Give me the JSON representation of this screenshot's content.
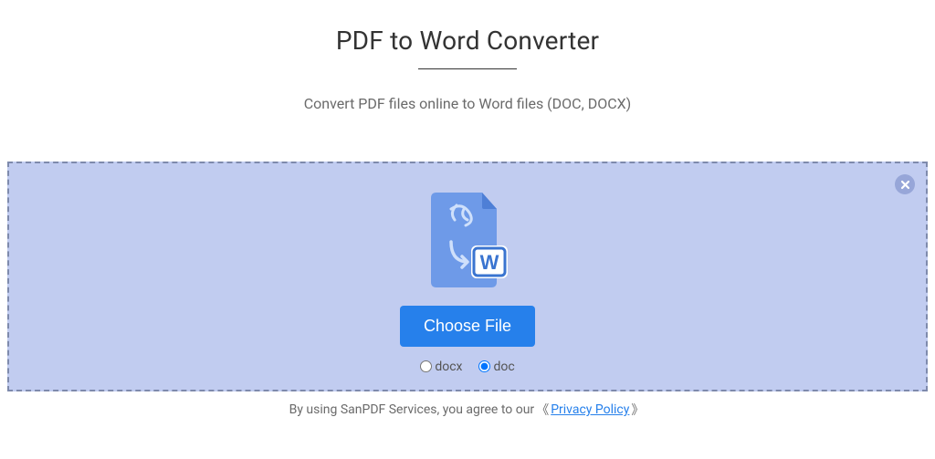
{
  "header": {
    "title": "PDF to Word Converter",
    "subtitle": "Convert PDF files online to Word files (DOC, DOCX)"
  },
  "dropzone": {
    "choose_button": "Choose File",
    "close_label": "close",
    "options": {
      "docx": "docx",
      "doc": "doc",
      "selected": "doc"
    }
  },
  "footer": {
    "prefix": "By using SanPDF Services, you agree to our ",
    "bracket_open": "《",
    "link_label": "Privacy Policy",
    "bracket_close": "》"
  },
  "icons": {
    "pdf_to_word": "pdf-to-word-icon",
    "close": "close-icon"
  }
}
